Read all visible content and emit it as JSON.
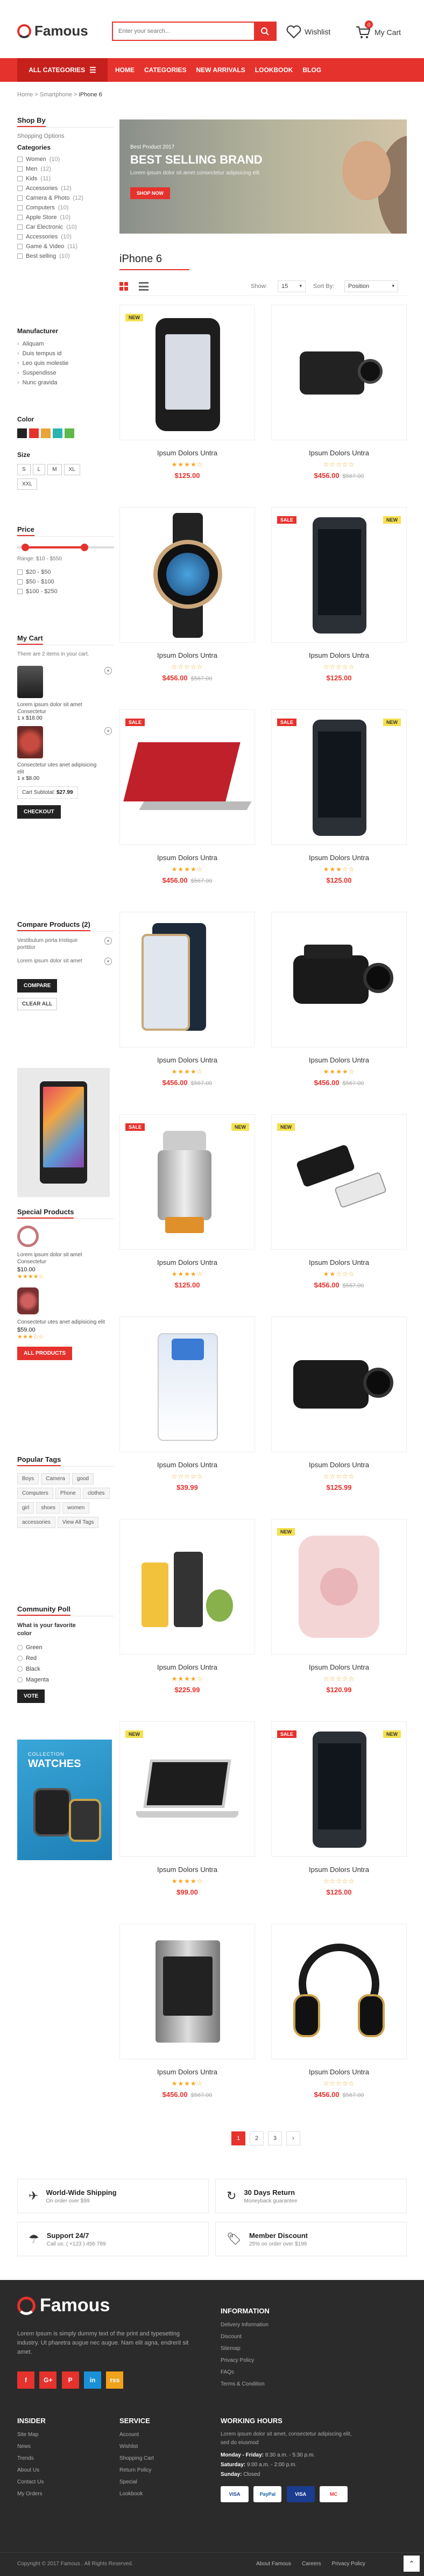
{
  "header": {
    "logo": "Famous",
    "search_placeholder": "Enter your search...",
    "wishlist": "Wishlist",
    "cart": "My Cart",
    "cart_count": "0"
  },
  "nav": {
    "all_categories": "ALL CATEGORIES",
    "links": [
      "HOME",
      "CATEGORIES",
      "NEW ARRIVALS",
      "LOOKBOOK",
      "BLOG"
    ]
  },
  "breadcrumb": {
    "home": "Home",
    "mid": "Smartphone",
    "current": "iPhone 6"
  },
  "sidebar": {
    "shop_by": "Shop By",
    "shopping_options": "Shopping Options",
    "categories_title": "Categories",
    "categories": [
      {
        "label": "Women",
        "count": "(10)"
      },
      {
        "label": "Men",
        "count": "(12)"
      },
      {
        "label": "Kids",
        "count": "(11)"
      },
      {
        "label": "Accessories",
        "count": "(12)"
      },
      {
        "label": "Camera & Photo",
        "count": "(12)"
      },
      {
        "label": "Computers",
        "count": "(10)"
      },
      {
        "label": "Apple Store",
        "count": "(10)"
      },
      {
        "label": "Car Electronic",
        "count": "(10)"
      },
      {
        "label": "Accessories",
        "count": "(10)"
      },
      {
        "label": "Game & Video",
        "count": "(11)"
      },
      {
        "label": "Best selling",
        "count": "(10)"
      }
    ],
    "manufacturer_title": "Manufacturer",
    "manufacturers": [
      "Aliquam",
      "Duis tempus id",
      "Leo quis molestie",
      "Suspendisse",
      "Nunc gravida"
    ],
    "color_title": "Color",
    "colors": [
      "#222222",
      "#e5322d",
      "#e8a33a",
      "#2bb5b0",
      "#5fb84a"
    ],
    "size_title": "Size",
    "sizes": [
      "S",
      "L",
      "M",
      "XL",
      "XXL"
    ],
    "price_title": "Price",
    "price_range": "Range: $10 - $550",
    "price_options": [
      "$20 - $50",
      "$50 - $100",
      "$100 - $250"
    ],
    "cart_title": "My Cart",
    "cart_intro": "There are 2 items in your cart.",
    "cart_items": [
      {
        "name": "Lorem ipsum dolor sit amet Consectetur",
        "qty_price": "1 x $18.00"
      },
      {
        "name": "Consectetur utes anet adipisicing elit",
        "qty_price": "1 x $8.00"
      }
    ],
    "cart_subtotal_label": "Cart Subtotal:",
    "cart_subtotal": "$27.99",
    "checkout": "CHECKOUT",
    "compare_title": "Compare Products",
    "compare_count": "(2)",
    "compare_items": [
      "Vestibulum porta tristique porttitor",
      "Lorem ipsum dolor sit amet"
    ],
    "compare_btn": "COMPARE",
    "clear_all": "CLEAR ALL",
    "specials_title": "Special Products",
    "specials": [
      {
        "name": "Lorem ipsum dolor sit amet Consectetur",
        "price": "$10.00",
        "stars": "★★★★☆"
      },
      {
        "name": "Consectetur utes anet adipisicing elit",
        "price": "$59.00",
        "stars": "★★★☆☆"
      }
    ],
    "all_products": "ALL PRODUCTS",
    "tags_title": "Popular Tags",
    "tags": [
      "Boys",
      "Camera",
      "good",
      "Computers",
      "Phone",
      "clothes",
      "girl",
      "shoes",
      "women",
      "accessories",
      "View All Tags"
    ],
    "poll_title": "Community Poll",
    "poll_question": "What is your favorite color",
    "poll_options": [
      "Green",
      "Red",
      "Black",
      "Magenta"
    ],
    "vote": "VOTE",
    "ad_small": "COLLECTION",
    "ad_big": "WATCHES"
  },
  "banner": {
    "small": "Best Product 2017",
    "title": "BEST SELLING BRAND",
    "sub": "Lorem ipsum dolor sit amet consectetur adipisicing elit",
    "button": "SHOP NOW"
  },
  "listing": {
    "title": "iPhone 6",
    "show_label": "Show:",
    "show_value": "15",
    "sort_label": "Sort By:",
    "sort_value": "Position"
  },
  "products": [
    {
      "name": "Ipsum Dolors Untra",
      "price": "$125.00",
      "old": "",
      "stars": "★★★★☆",
      "badge": "NEW"
    },
    {
      "name": "Ipsum Dolors Untra",
      "price": "$456.00",
      "old": "$567.00",
      "stars": "☆☆☆☆☆",
      "badge": ""
    },
    {
      "name": "Ipsum Dolors Untra",
      "price": "$456.00",
      "old": "$567.00",
      "stars": "☆☆☆☆☆",
      "badge": ""
    },
    {
      "name": "Ipsum Dolors Untra",
      "price": "$125.00",
      "old": "",
      "stars": "☆☆☆☆☆",
      "badge": "SALE NEW"
    },
    {
      "name": "Ipsum Dolors Untra",
      "price": "$456.00",
      "old": "$567.00",
      "stars": "★★★★☆",
      "badge": "SALE"
    },
    {
      "name": "Ipsum Dolors Untra",
      "price": "$125.00",
      "old": "",
      "stars": "★★★☆☆",
      "badge": "SALE NEW"
    },
    {
      "name": "Ipsum Dolors Untra",
      "price": "$456.00",
      "old": "$567.00",
      "stars": "★★★★☆",
      "badge": ""
    },
    {
      "name": "Ipsum Dolors Untra",
      "price": "$456.00",
      "old": "$567.00",
      "stars": "★★★★☆",
      "badge": ""
    },
    {
      "name": "Ipsum Dolors Untra",
      "price": "$125.00",
      "old": "",
      "stars": "★★★★☆",
      "badge": "SALE NEW"
    },
    {
      "name": "Ipsum Dolors Untra",
      "price": "$456.00",
      "old": "$567.00",
      "stars": "★★☆☆☆",
      "badge": "NEW"
    },
    {
      "name": "Ipsum Dolors Untra",
      "price": "$39.99",
      "old": "",
      "stars": "☆☆☆☆☆",
      "badge": ""
    },
    {
      "name": "Ipsum Dolors Untra",
      "price": "$125.99",
      "old": "",
      "stars": "☆☆☆☆☆",
      "badge": ""
    },
    {
      "name": "Ipsum Dolors Untra",
      "price": "$225.99",
      "old": "",
      "stars": "★★★★☆",
      "badge": ""
    },
    {
      "name": "Ipsum Dolors Untra",
      "price": "$120.99",
      "old": "",
      "stars": "☆☆☆☆☆",
      "badge": "NEW"
    },
    {
      "name": "Ipsum Dolors Untra",
      "price": "$99.00",
      "old": "",
      "stars": "★★★★☆",
      "badge": "NEW"
    },
    {
      "name": "Ipsum Dolors Untra",
      "price": "$125.00",
      "old": "",
      "stars": "☆☆☆☆☆",
      "badge": "SALE NEW"
    },
    {
      "name": "Ipsum Dolors Untra",
      "price": "$456.00",
      "old": "$567.00",
      "stars": "★★★★☆",
      "badge": ""
    },
    {
      "name": "Ipsum Dolors Untra",
      "price": "$456.00",
      "old": "$567.00",
      "stars": "☆☆☆☆☆",
      "badge": ""
    }
  ],
  "pagination": [
    "1",
    "2",
    "3",
    "›"
  ],
  "services": [
    {
      "title": "World-Wide Shipping",
      "sub": "On order over $99"
    },
    {
      "title": "30 Days Return",
      "sub": "Moneyback guarantee"
    },
    {
      "title": "Support 24/7",
      "sub": "Call us: ( +123 ) 456 789"
    },
    {
      "title": "Member Discount",
      "sub": "25% on order over $199"
    }
  ],
  "footer": {
    "logo": "Famous",
    "about": "Lorem Ipsum is simply dummy text of the print and typesetting industry. Ut pharetra augue nec augue. Nam elit agna, endrerit sit amet.",
    "social": [
      "f",
      "G+",
      "P",
      "in",
      "rss"
    ],
    "info_title": "INFORMATION",
    "info_links": [
      "Delivery Information",
      "Discount",
      "Sitemap",
      "Privacy Policy",
      "FAQs",
      "Terms & Condition"
    ],
    "insider_title": "INSIDER",
    "insider_links": [
      "Site Map",
      "News",
      "Trends",
      "About Us",
      "Contact Us",
      "My Orders"
    ],
    "service_title": "SERVICE",
    "service_links": [
      "Account",
      "Wishlist",
      "Shopping Cart",
      "Return Policy",
      "Special",
      "Lookbook"
    ],
    "hours_title": "WORKING HOURS",
    "hours_text": "Lorem ipsum dolor sit amet, consectetur adipiscing elit, sed do eiusmod",
    "hours": [
      {
        "day": "Monday - Friday:",
        "time": "8:30 a.m. - 5:30 p.m."
      },
      {
        "day": "Saturday:",
        "time": "9:00 a.m. - 2:00 p.m."
      },
      {
        "day": "Sunday:",
        "time": "Closed"
      }
    ],
    "payments": [
      "VISA",
      "PayPal",
      "VISA",
      "MC"
    ],
    "copyright": "Copyright © 2017 Famous . All Rights Reserved.",
    "bottom_links": [
      "About Famous",
      "Careers",
      "Privacy Policy"
    ]
  }
}
